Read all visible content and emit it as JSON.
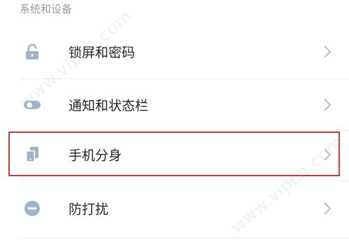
{
  "section": {
    "title": "系统和设备"
  },
  "rows": [
    {
      "label": "锁屏和密码",
      "icon": "lock-icon"
    },
    {
      "label": "通知和状态栏",
      "icon": "toggle-icon"
    },
    {
      "label": "手机分身",
      "icon": "dual-phone-icon",
      "highlighted": true
    },
    {
      "label": "防打扰",
      "icon": "do-not-disturb-icon"
    }
  ],
  "watermark": {
    "text": "www.vipcn.com"
  },
  "colors": {
    "icon": "#a3b3c6",
    "text": "#262626",
    "section": "#9a9a9a",
    "highlight_border": "#c8383a",
    "chevron": "#b5b5b5"
  }
}
